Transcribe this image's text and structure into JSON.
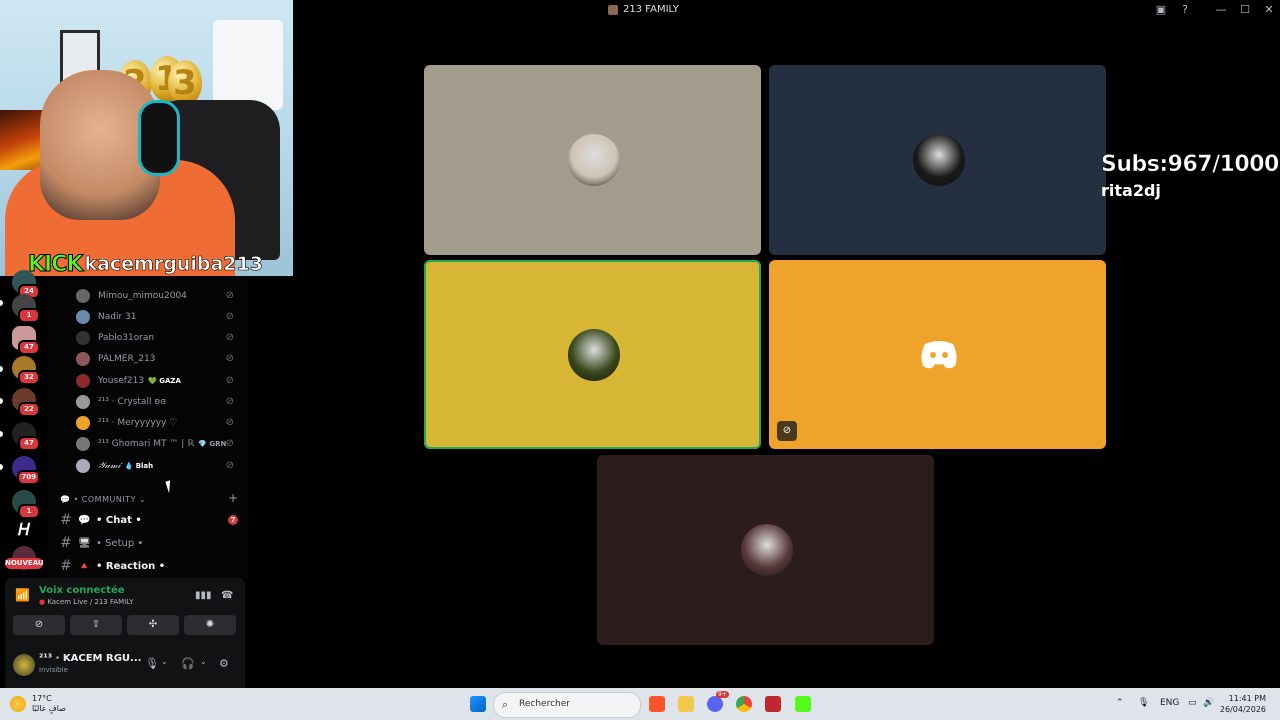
{
  "window": {
    "title": "213 FAMILY"
  },
  "stream_overlay": {
    "kick_logo": "KICK",
    "kick_channel": "kacemrguiba213",
    "balloon_digits": [
      "2",
      "1",
      "3"
    ],
    "subs": "Subs:967/1000",
    "follower": "rita2dj"
  },
  "server_rail": {
    "badges": [
      "24",
      "1",
      "47",
      "32",
      "22",
      "47",
      "709",
      "1"
    ],
    "nouveau_label": "NOUVEAU"
  },
  "voice_members": [
    {
      "name": "Mimou_mimou2004",
      "tag": ""
    },
    {
      "name": "Nadir 31",
      "tag": ""
    },
    {
      "name": "Pablo31oran",
      "tag": ""
    },
    {
      "name": "PALMER_213",
      "tag": ""
    },
    {
      "name": "Yousef213",
      "tag": "💚 GAZA"
    },
    {
      "name": "²¹³ · Crystall ʚɞ",
      "tag": ""
    },
    {
      "name": "²¹³ · Meryyyyyy ♡",
      "tag": ""
    },
    {
      "name": "²¹³ Ghomari MT ™ | ℝ",
      "tag": "💎 GRN"
    },
    {
      "name": "𝒴𝒶𝓂𝒾",
      "tag": "💧 Blah"
    }
  ],
  "community": {
    "category": "• COMMUNITY ⌄",
    "plus": "+",
    "channels": [
      {
        "emoji": "💬",
        "label": "• Chat •",
        "unread": "7",
        "bold": true
      },
      {
        "emoji": "🖥",
        "label": "• Setup •",
        "unread": "",
        "bold": false
      },
      {
        "emoji": "🔺",
        "label": "• Reaction •",
        "unread": "",
        "bold": true
      }
    ]
  },
  "voice_panel": {
    "status": "Voix connectée",
    "location": "Kacem Live / 213 FAMILY",
    "buttons": [
      "camera-off",
      "screen-share",
      "activities",
      "soundboard"
    ]
  },
  "user_panel": {
    "name": "²¹³ · KACEM RGU...",
    "status": "Invisible"
  },
  "tiles": [
    {
      "bg": "#a39b8c",
      "avatar": "#cfc3b4",
      "speaking": false,
      "muted": false
    },
    {
      "bg": "#24303f",
      "avatar": "#1a1a1a",
      "speaking": false,
      "muted": false
    },
    {
      "bg": "#d6b634",
      "avatar": "#3b4a1d",
      "speaking": true,
      "muted": false
    },
    {
      "bg": "#f0a32a",
      "avatar": "discord",
      "speaking": false,
      "muted": true
    },
    {
      "bg": "#2c1c1c",
      "avatar": "#5a3a3a",
      "speaking": false,
      "muted": false
    }
  ],
  "taskbar": {
    "temperature": "17°C",
    "weather_desc": "صافٍ غالبًا",
    "search_placeholder": "Rechercher",
    "lang": "ENG",
    "time": "11:41 PM",
    "date": "26/04/2026",
    "discord_badge": "9+"
  }
}
